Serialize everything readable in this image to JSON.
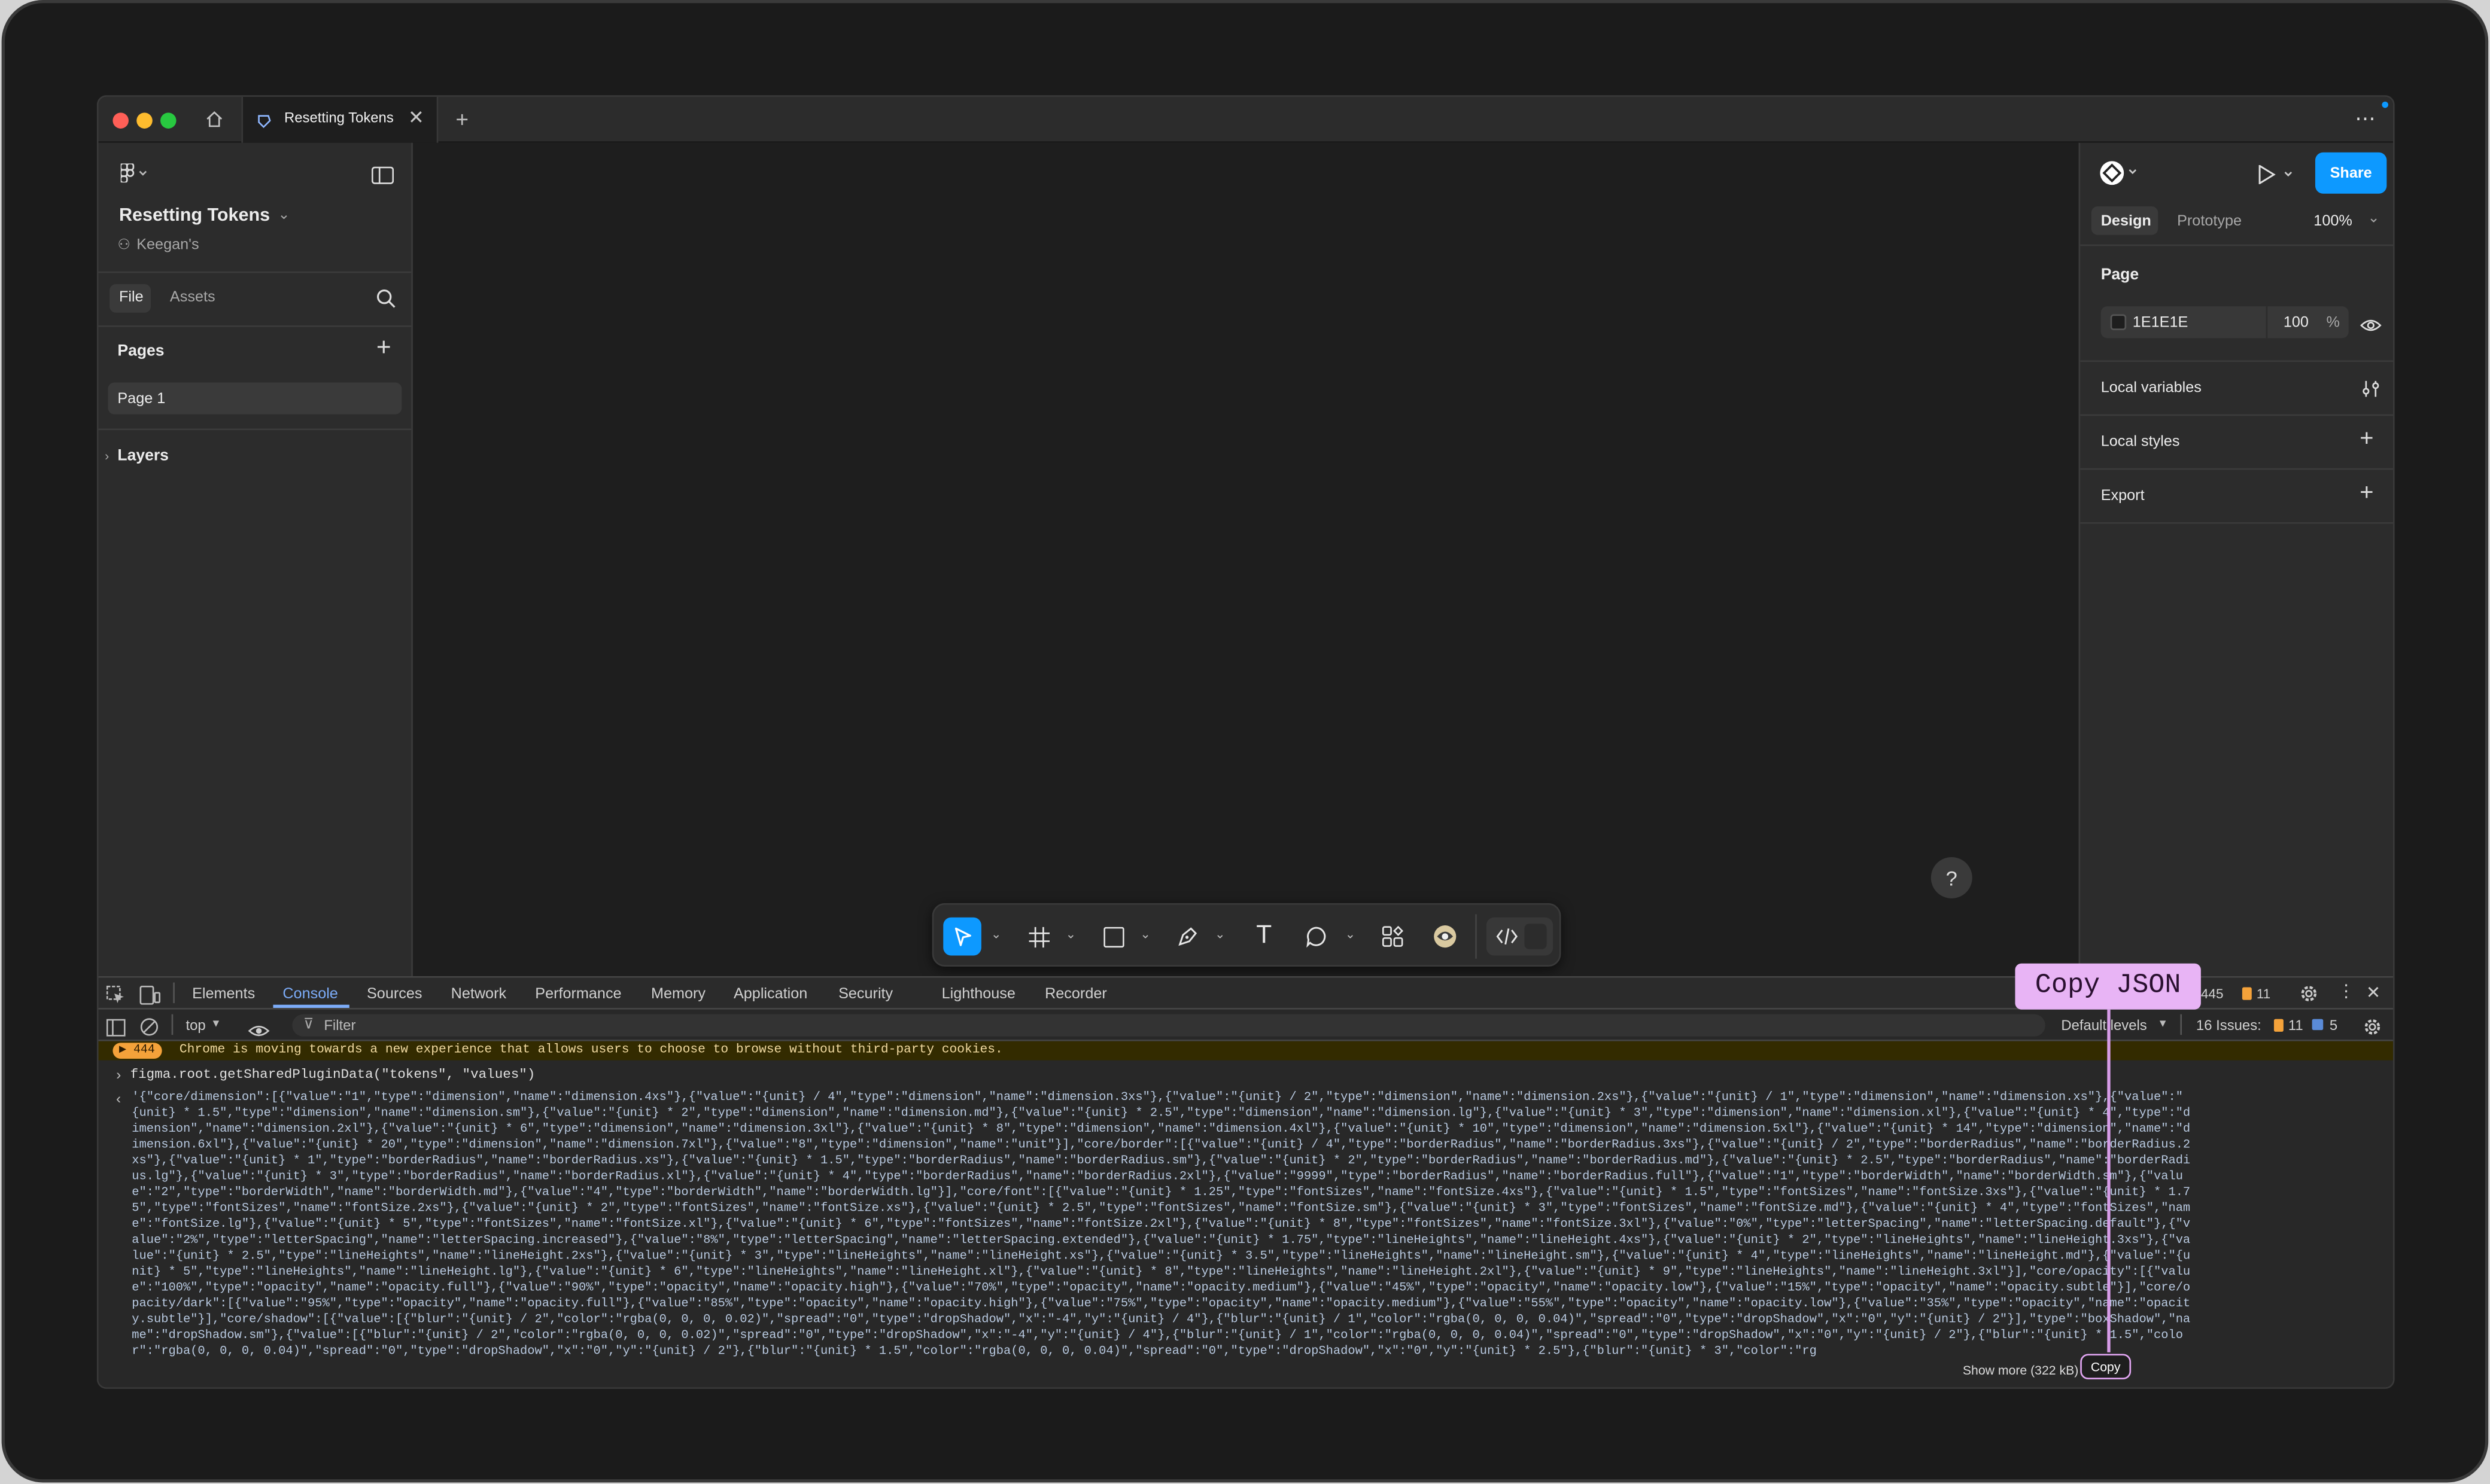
{
  "window": {
    "tab_title": "Resetting Tokens",
    "more_label": "⋯"
  },
  "left_panel": {
    "file_name": "Resetting Tokens",
    "team": "Keegan's",
    "tabs": [
      "File",
      "Assets"
    ],
    "pages_label": "Pages",
    "pages": [
      "Page 1"
    ],
    "layers_label": "Layers"
  },
  "right_panel": {
    "share_label": "Share",
    "design_tab": "Design",
    "prototype_tab": "Prototype",
    "zoom": "100%",
    "page_label": "Page",
    "page_color": "1E1E1E",
    "page_opacity": "100",
    "percent": "%",
    "sections": [
      "Local variables",
      "Local styles",
      "Export"
    ]
  },
  "devtools": {
    "tabs": [
      "Elements",
      "Console",
      "Sources",
      "Network",
      "Performance",
      "Memory",
      "Application",
      "Security",
      "Lighthouse",
      "Recorder"
    ],
    "active_tab": "Console",
    "count": "445",
    "warn_count": "11",
    "context": "top",
    "filter_placeholder": "Filter",
    "levels": "Default levels",
    "issues_label": "16 Issues:",
    "issues_warn": "11",
    "issues_info": "5",
    "warning_badge": "444",
    "warning_text": "Chrome is moving towards a new experience that allows users to choose to browse without third-party cookies.",
    "command": "figma.root.getSharedPluginData(\"tokens\", \"values\")",
    "output_lines": [
      "'{\"core/dimension\":[{\"value\":\"1\",\"type\":\"dimension\",\"name\":\"dimension.4xs\"},{\"value\":\"{unit} / 4\",\"type\":\"dimension\",\"name\":\"dimension.3xs\"},{\"value\":\"{unit} / 2\",\"type\":\"dimension\",\"name\":\"dimension.2xs\"},{\"value\":\"{unit} / 1\",\"type\":\"dimension\",\"name\":\"dimension.xs\"},{\"value\":\"",
      "{unit} * 1.5\",\"type\":\"dimension\",\"name\":\"dimension.sm\"},{\"value\":\"{unit} * 2\",\"type\":\"dimension\",\"name\":\"dimension.md\"},{\"value\":\"{unit} * 2.5\",\"type\":\"dimension\",\"name\":\"dimension.lg\"},{\"value\":\"{unit} * 3\",\"type\":\"dimension\",\"name\":\"dimension.xl\"},{\"value\":\"{unit} * 4\",\"type\":\"d",
      "imension\",\"name\":\"dimension.2xl\"},{\"value\":\"{unit} * 6\",\"type\":\"dimension\",\"name\":\"dimension.3xl\"},{\"value\":\"{unit} * 8\",\"type\":\"dimension\",\"name\":\"dimension.4xl\"},{\"value\":\"{unit} * 10\",\"type\":\"dimension\",\"name\":\"dimension.5xl\"},{\"value\":\"{unit} * 14\",\"type\":\"dimension\",\"name\":\"d",
      "imension.6xl\"},{\"value\":\"{unit} * 20\",\"type\":\"dimension\",\"name\":\"dimension.7xl\"},{\"value\":\"8\",\"type\":\"dimension\",\"name\":\"unit\"}],\"core/border\":[{\"value\":\"{unit} / 4\",\"type\":\"borderRadius\",\"name\":\"borderRadius.3xs\"},{\"value\":\"{unit} / 2\",\"type\":\"borderRadius\",\"name\":\"borderRadius.2",
      "xs\"},{\"value\":\"{unit} * 1\",\"type\":\"borderRadius\",\"name\":\"borderRadius.xs\"},{\"value\":\"{unit} * 1.5\",\"type\":\"borderRadius\",\"name\":\"borderRadius.sm\"},{\"value\":\"{unit} * 2\",\"type\":\"borderRadius\",\"name\":\"borderRadius.md\"},{\"value\":\"{unit} * 2.5\",\"type\":\"borderRadius\",\"name\":\"borderRadi",
      "us.lg\"},{\"value\":\"{unit} * 3\",\"type\":\"borderRadius\",\"name\":\"borderRadius.xl\"},{\"value\":\"{unit} * 4\",\"type\":\"borderRadius\",\"name\":\"borderRadius.2xl\"},{\"value\":\"9999\",\"type\":\"borderRadius\",\"name\":\"borderRadius.full\"},{\"value\":\"1\",\"type\":\"borderWidth\",\"name\":\"borderWidth.sm\"},{\"valu",
      "e\":\"2\",\"type\":\"borderWidth\",\"name\":\"borderWidth.md\"},{\"value\":\"4\",\"type\":\"borderWidth\",\"name\":\"borderWidth.lg\"}],\"core/font\":[{\"value\":\"{unit} * 1.25\",\"type\":\"fontSizes\",\"name\":\"fontSize.4xs\"},{\"value\":\"{unit} * 1.5\",\"type\":\"fontSizes\",\"name\":\"fontSize.3xs\"},{\"value\":\"{unit} * 1.7",
      "5\",\"type\":\"fontSizes\",\"name\":\"fontSize.2xs\"},{\"value\":\"{unit} * 2\",\"type\":\"fontSizes\",\"name\":\"fontSize.xs\"},{\"value\":\"{unit} * 2.5\",\"type\":\"fontSizes\",\"name\":\"fontSize.sm\"},{\"value\":\"{unit} * 3\",\"type\":\"fontSizes\",\"name\":\"fontSize.md\"},{\"value\":\"{unit} * 4\",\"type\":\"fontSizes\",\"nam",
      "e\":\"fontSize.lg\"},{\"value\":\"{unit} * 5\",\"type\":\"fontSizes\",\"name\":\"fontSize.xl\"},{\"value\":\"{unit} * 6\",\"type\":\"fontSizes\",\"name\":\"fontSize.2xl\"},{\"value\":\"{unit} * 8\",\"type\":\"fontSizes\",\"name\":\"fontSize.3xl\"},{\"value\":\"0%\",\"type\":\"letterSpacing\",\"name\":\"letterSpacing.default\"},{\"v",
      "alue\":\"2%\",\"type\":\"letterSpacing\",\"name\":\"letterSpacing.increased\"},{\"value\":\"8%\",\"type\":\"letterSpacing\",\"name\":\"letterSpacing.extended\"},{\"value\":\"{unit} * 1.75\",\"type\":\"lineHeights\",\"name\":\"lineHeight.4xs\"},{\"value\":\"{unit} * 2\",\"type\":\"lineHeights\",\"name\":\"lineHeight.3xs\"},{\"va",
      "lue\":\"{unit} * 2.5\",\"type\":\"lineHeights\",\"name\":\"lineHeight.2xs\"},{\"value\":\"{unit} * 3\",\"type\":\"lineHeights\",\"name\":\"lineHeight.xs\"},{\"value\":\"{unit} * 3.5\",\"type\":\"lineHeights\",\"name\":\"lineHeight.sm\"},{\"value\":\"{unit} * 4\",\"type\":\"lineHeights\",\"name\":\"lineHeight.md\"},{\"value\":\"{u",
      "nit} * 5\",\"type\":\"lineHeights\",\"name\":\"lineHeight.lg\"},{\"value\":\"{unit} * 6\",\"type\":\"lineHeights\",\"name\":\"lineHeight.xl\"},{\"value\":\"{unit} * 8\",\"type\":\"lineHeights\",\"name\":\"lineHeight.2xl\"},{\"value\":\"{unit} * 9\",\"type\":\"lineHeights\",\"name\":\"lineHeight.3xl\"}],\"core/opacity\":[{\"valu",
      "e\":\"100%\",\"type\":\"opacity\",\"name\":\"opacity.full\"},{\"value\":\"90%\",\"type\":\"opacity\",\"name\":\"opacity.high\"},{\"value\":\"70%\",\"type\":\"opacity\",\"name\":\"opacity.medium\"},{\"value\":\"45%\",\"type\":\"opacity\",\"name\":\"opacity.low\"},{\"value\":\"15%\",\"type\":\"opacity\",\"name\":\"opacity.subtle\"}],\"core/o",
      "pacity/dark\":[{\"value\":\"95%\",\"type\":\"opacity\",\"name\":\"opacity.full\"},{\"value\":\"85%\",\"type\":\"opacity\",\"name\":\"opacity.high\"},{\"value\":\"75%\",\"type\":\"opacity\",\"name\":\"opacity.medium\"},{\"value\":\"55%\",\"type\":\"opacity\",\"name\":\"opacity.low\"},{\"value\":\"35%\",\"type\":\"opacity\",\"name\":\"opacit",
      "y.subtle\"}],\"core/shadow\":[{\"value\":[{\"blur\":\"{unit} / 2\",\"color\":\"rgba(0, 0, 0, 0.02)\",\"spread\":\"0\",\"type\":\"dropShadow\",\"x\":\"-4\",\"y\":\"{unit} / 4\"},{\"blur\":\"{unit} / 1\",\"color\":\"rgba(0, 0, 0, 0.04)\",\"spread\":\"0\",\"type\":\"dropShadow\",\"x\":\"0\",\"y\":\"{unit} / 2\"}],\"type\":\"boxShadow\",\"na",
      "me\":\"dropShadow.sm\"},{\"value\":[{\"blur\":\"{unit} / 2\",\"color\":\"rgba(0, 0, 0, 0.02)\",\"spread\":\"0\",\"type\":\"dropShadow\",\"x\":\"-4\",\"y\":\"{unit} / 4\"},{\"blur\":\"{unit} / 1\",\"color\":\"rgba(0, 0, 0, 0.04)\",\"spread\":\"0\",\"type\":\"dropShadow\",\"x\":\"0\",\"y\":\"{unit} / 2\"},{\"blur\":\"{unit} * 1.5\",\"colo",
      "r\":\"rgba(0, 0, 0, 0.04)\",\"spread\":\"0\",\"type\":\"dropShadow\",\"x\":\"0\",\"y\":\"{unit} / 2\"},{\"blur\":\"{unit} * 1.5\",\"color\":\"rgba(0, 0, 0, 0.04)\",\"spread\":\"0\",\"type\":\"dropShadow\",\"x\":\"0\",\"y\":\"{unit} * 2.5\"},{\"blur\":\"{unit} * 3\",\"color\":\"rg"
    ],
    "show_more": "Show more (322 kB)",
    "copy_label": "Copy"
  },
  "callout": "Copy JSON",
  "help_label": "?",
  "colors": {
    "accent": "#0d99ff",
    "callout": "#e8b4f5",
    "console_tab": "#7cacf8",
    "warning": "#f4a23a"
  },
  "icons": [
    "home-icon",
    "plus-icon",
    "search-icon",
    "eye-icon",
    "sliders-icon",
    "play-icon",
    "move-tool-icon",
    "frame-tool-icon",
    "rectangle-tool-icon",
    "pen-tool-icon",
    "text-tool-icon",
    "comment-tool-icon",
    "components-icon",
    "plugin-icon",
    "code-icon",
    "gear-icon",
    "kebab-icon",
    "close-icon"
  ]
}
